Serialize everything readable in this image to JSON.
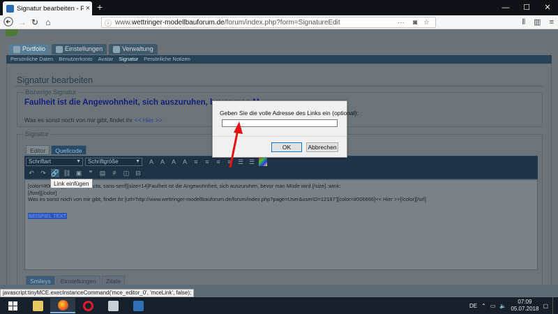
{
  "browser": {
    "tab_title": "Signatur bearbeiten - Portfolio",
    "tab_close": "×",
    "new_tab": "+",
    "url_prefix": "www.",
    "url_domain": "wettringer-modellbauforum.de",
    "url_path": "/forum/index.php?form=SignatureEdit",
    "window_controls": [
      "—",
      "☐",
      "✕"
    ]
  },
  "site": {
    "main_tabs": [
      "Portfolio",
      "Einstellungen",
      "Verwaltung"
    ],
    "sub_nav": [
      "Persönliche Daten",
      "Benutzerkonto",
      "Avatar",
      "Signatur",
      "Persönliche Notizen"
    ],
    "sub_nav_active": "Signatur",
    "page_title": "Signatur bearbeiten",
    "previous_legend": "Bisherige Signatur",
    "previous_big": "Faulheit ist die Angewohnheit, sich auszuruhen, bevor man M",
    "previous_small_text": "Was es sonst noch von mir gibt, findet ihr ",
    "previous_small_link": "<< Hier >>",
    "signature_legend": "Signatur",
    "editor_tabs": [
      "Editor",
      "Quellcode"
    ],
    "font_select": "Schriftart",
    "size_select": "Schriftgröße",
    "editor_lines": [
      "[color=#0000ff][                  ject, Compacta, sans-serif][size=14]Faulheit ist die Angewohnheit, sich auszuruhen, bevor man Müde wird.[/size] :wink:",
      "[/font][/color]",
      "Was es sonst noch von mir gibt, findet ihr [url='http://www.wettringer-modellbauforum.de/forum/index.php?page=User&userID=12187'][color=#006666]<< Hier >>[/color][/url]"
    ],
    "editor_highlight": "BEISPIEL TEXT",
    "tooltip": "Link einfügen",
    "bottom_tabs": [
      "Smileys",
      "Einstellungen",
      "Zitate"
    ]
  },
  "dialog": {
    "prompt": "Geben Sie die volle Adresse des Links ein (optional):",
    "input_value": "",
    "ok_label": "OK",
    "cancel_label": "Abbrechen"
  },
  "status_url": "javascript:tinyMCE.execInstanceCommand('mce_editor_0', 'mceLink', false);",
  "taskbar": {
    "language": "DE",
    "time": "07:09",
    "date": "05.07.2018"
  },
  "colors": {
    "annotation_arrow": "#e81010",
    "signature_blue": "#121f7a"
  }
}
